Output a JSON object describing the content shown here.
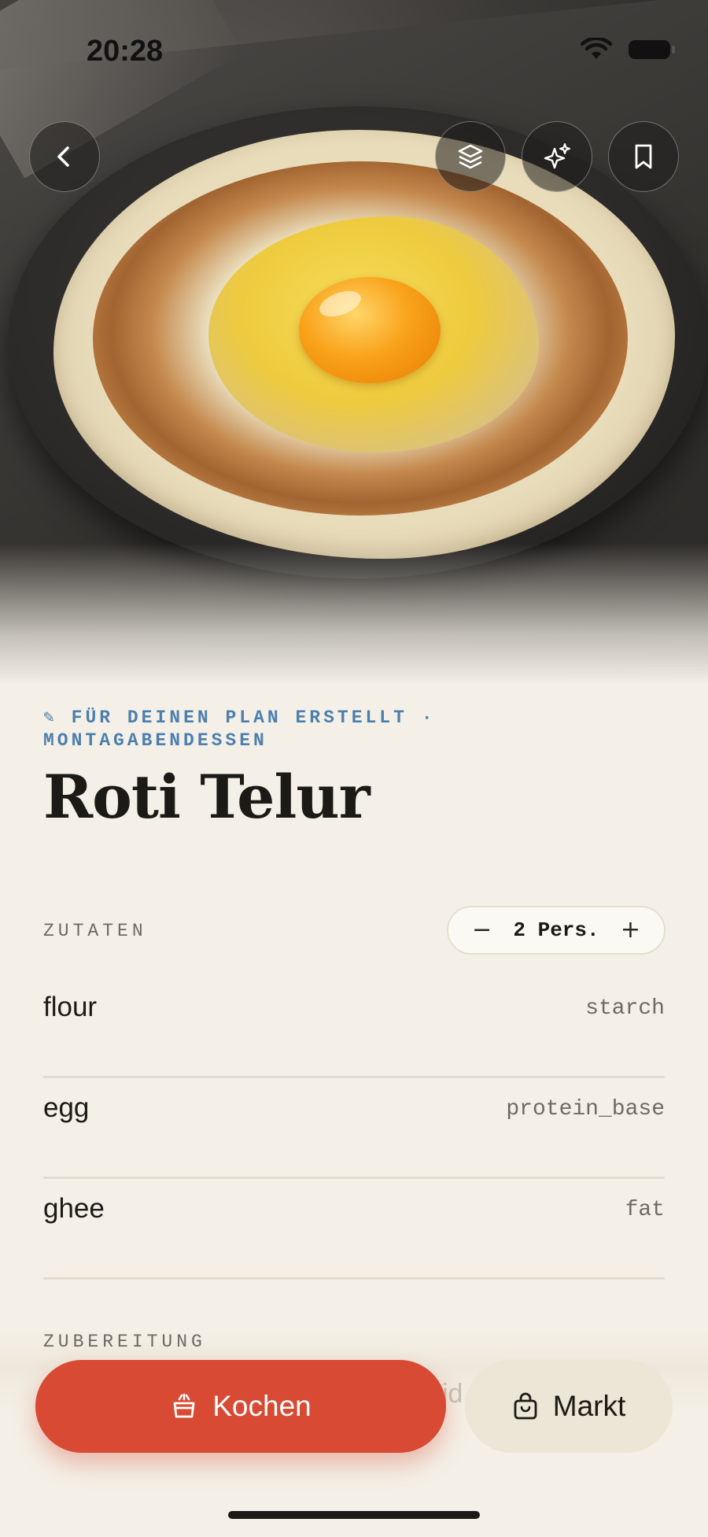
{
  "status_bar": {
    "time": "20:28"
  },
  "top_actions": {
    "back_icon": "chevron-left-icon",
    "layers_icon": "layers-icon",
    "sparkles_icon": "sparkles-icon",
    "bookmark_icon": "bookmark-icon"
  },
  "recipe": {
    "eyebrow": "✎ FÜR DEINEN PLAN ERSTELLT · MONTAGABENDESSEN",
    "title": "Roti Telur"
  },
  "ingredients_section": {
    "label": "ZUTATEN",
    "servings": {
      "minus": "−",
      "value": "2 Pers.",
      "plus": "+"
    },
    "items": [
      {
        "name": "flour",
        "category": "starch"
      },
      {
        "name": "egg",
        "category": "protein_base"
      },
      {
        "name": "ghee",
        "category": "fat"
      }
    ]
  },
  "preparation_section": {
    "label": "ZUBEREITUNG",
    "partial_text": "id"
  },
  "actions": {
    "cook": {
      "label": "Kochen",
      "icon": "pot-icon"
    },
    "market": {
      "label": "Markt",
      "icon": "shopping-bag-icon"
    }
  },
  "colors": {
    "background": "#f4f0e7",
    "accent_red": "#d84a33",
    "eyebrow_blue": "#4c7fae",
    "market_bg": "#ece6d6"
  }
}
